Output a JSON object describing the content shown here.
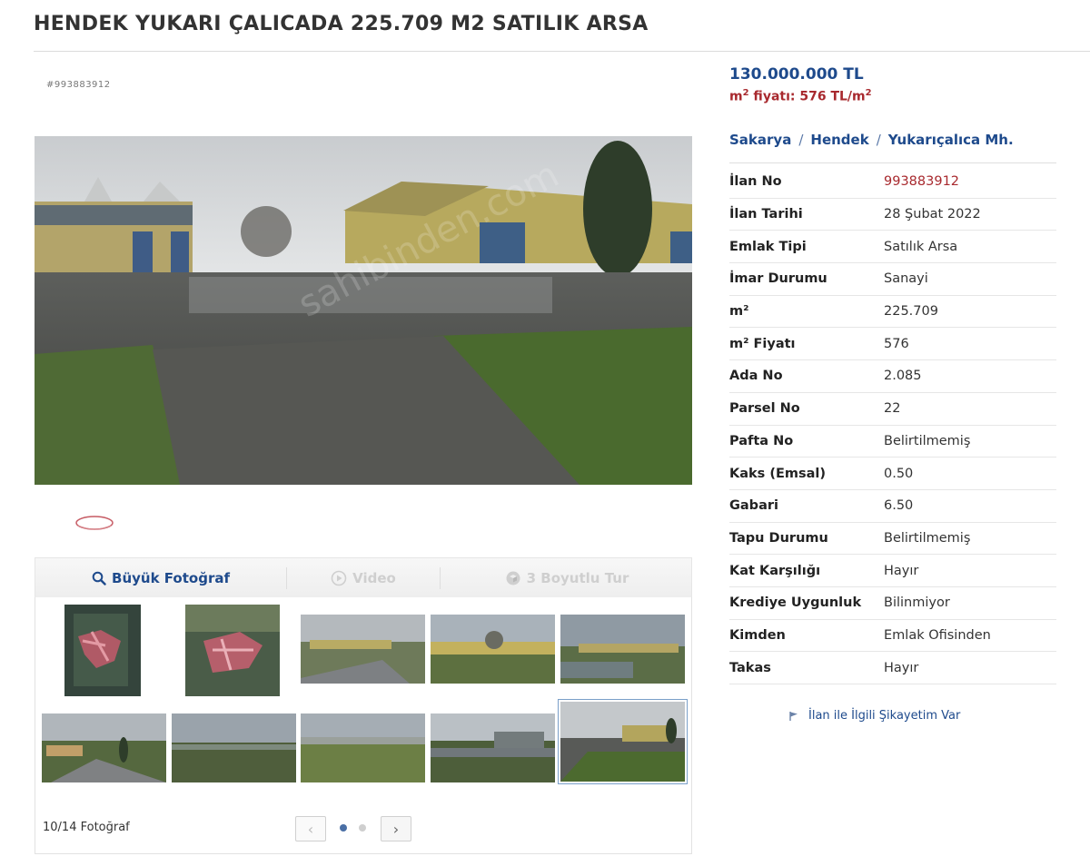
{
  "listing": {
    "title": "HENDEK YUKARI ÇALICADA 225.709 M2 SATILIK ARSA",
    "id_label": "#993883912",
    "watermark": "sahibinden.com"
  },
  "price": {
    "total": "130.000.000 TL",
    "unit_prefix": "m",
    "unit_sup": "2",
    "unit_mid": " fiyatı: 576 TL/m",
    "unit_sup2": "2"
  },
  "location": {
    "city": "Sakarya",
    "district": "Hendek",
    "neighborhood": "Yukarıçalıca Mh.",
    "separator": "/"
  },
  "details": [
    {
      "label": "İlan No",
      "value": "993883912",
      "highlight": true
    },
    {
      "label": "İlan Tarihi",
      "value": "28 Şubat 2022"
    },
    {
      "label": "Emlak Tipi",
      "value": "Satılık Arsa"
    },
    {
      "label": "İmar Durumu",
      "value": "Sanayi"
    },
    {
      "label": "m²",
      "value": "225.709"
    },
    {
      "label": "m² Fiyatı",
      "value": "576"
    },
    {
      "label": "Ada No",
      "value": "2.085"
    },
    {
      "label": "Parsel No",
      "value": "22"
    },
    {
      "label": "Pafta No",
      "value": "Belirtilmemiş"
    },
    {
      "label": "Kaks (Emsal)",
      "value": "0.50"
    },
    {
      "label": "Gabari",
      "value": "6.50"
    },
    {
      "label": "Tapu Durumu",
      "value": "Belirtilmemiş"
    },
    {
      "label": "Kat Karşılığı",
      "value": "Hayır"
    },
    {
      "label": "Krediye Uygunluk",
      "value": "Bilinmiyor"
    },
    {
      "label": "Kimden",
      "value": "Emlak Ofisinden"
    },
    {
      "label": "Takas",
      "value": "Hayır"
    }
  ],
  "media_tabs": {
    "large_photo": "Büyük Fotoğraf",
    "video": "Video",
    "tour": "3 Boyutlu Tur"
  },
  "gallery": {
    "count_label": "10/14 Fotoğraf",
    "prev": "‹",
    "next": "›",
    "selected_index": 10,
    "thumbnails": [
      {
        "kind": "satellite-map"
      },
      {
        "kind": "satellite-map"
      },
      {
        "kind": "site-photo"
      },
      {
        "kind": "site-photo"
      },
      {
        "kind": "site-photo"
      },
      {
        "kind": "site-photo"
      },
      {
        "kind": "site-photo"
      },
      {
        "kind": "site-photo"
      },
      {
        "kind": "site-photo"
      },
      {
        "kind": "site-photo",
        "selected": true
      }
    ]
  },
  "complaint_link": "İlan ile İlgili Şikayetim Var",
  "colors": {
    "link_blue": "#1e4a8c",
    "price_red": "#a8292e"
  },
  "icons": [
    "search-icon",
    "play-icon",
    "cube-icon",
    "flag-icon",
    "chevron-left-icon",
    "chevron-right-icon"
  ]
}
